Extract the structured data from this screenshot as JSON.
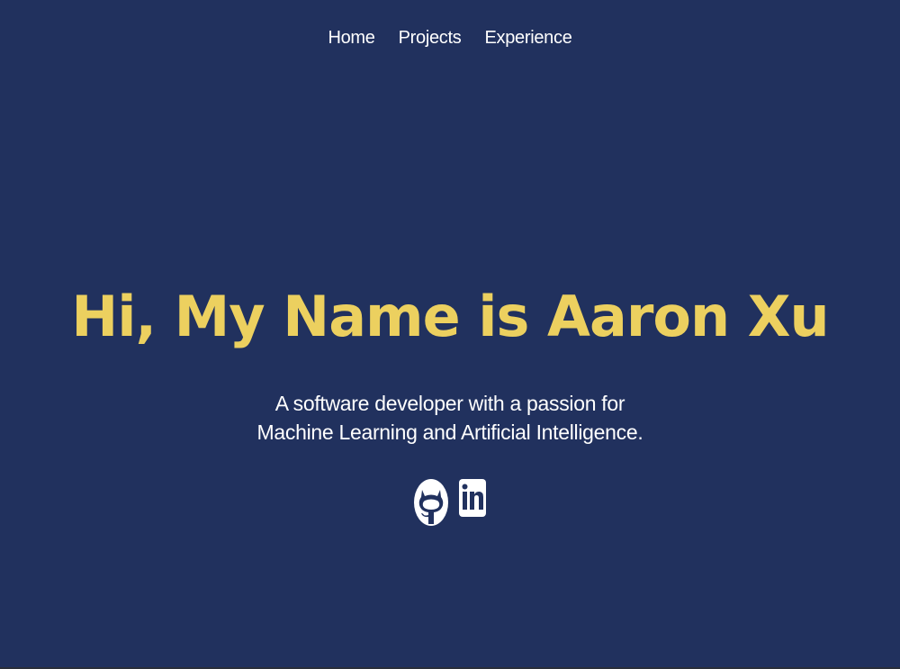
{
  "nav": {
    "items": [
      {
        "label": "Home"
      },
      {
        "label": "Projects"
      },
      {
        "label": "Experience"
      }
    ]
  },
  "hero": {
    "title": "Hi, My Name is Aaron Xu",
    "subtitle_line1": "A software developer with a passion for",
    "subtitle_line2": "Machine Learning and Artificial Intelligence."
  },
  "social": [
    {
      "icon": "github-icon"
    },
    {
      "icon": "linkedin-icon"
    }
  ],
  "colors": {
    "background": "#21315e",
    "accent": "#ecd05f",
    "text": "#ffffff"
  }
}
